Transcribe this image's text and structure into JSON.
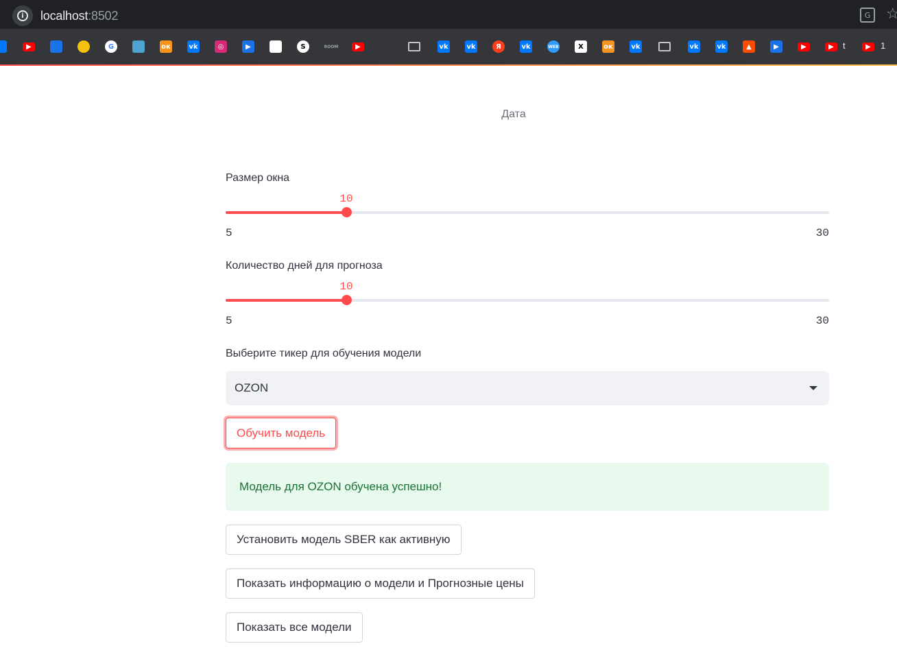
{
  "browser": {
    "url_host": "localhost",
    "url_port": ":8502",
    "info_icon": "info-icon",
    "translate_icon": "translate-icon",
    "star_icon": "bookmark-star-icon",
    "bookmark_texts": [
      "t",
      "1"
    ]
  },
  "chart": {
    "xlabel": "Дата"
  },
  "window_slider": {
    "label": "Размер окна",
    "value": "10",
    "min": "5",
    "max": "30",
    "accent": "#ff4b4b"
  },
  "forecast_slider": {
    "label": "Количество дней для прогноза",
    "value": "10",
    "min": "5",
    "max": "30",
    "accent": "#ff4b4b"
  },
  "ticker": {
    "label": "Выберите тикер для обучения модели",
    "selected": "OZON"
  },
  "buttons": {
    "train": "Обучить модель",
    "set_active": "Установить модель SBER как активную",
    "show_info": "Показать информацию о модели и Прогнозные цены",
    "show_all": "Показать все модели"
  },
  "alert": {
    "message": "Модель для OZON обучена успешно!",
    "color": "#177233"
  }
}
